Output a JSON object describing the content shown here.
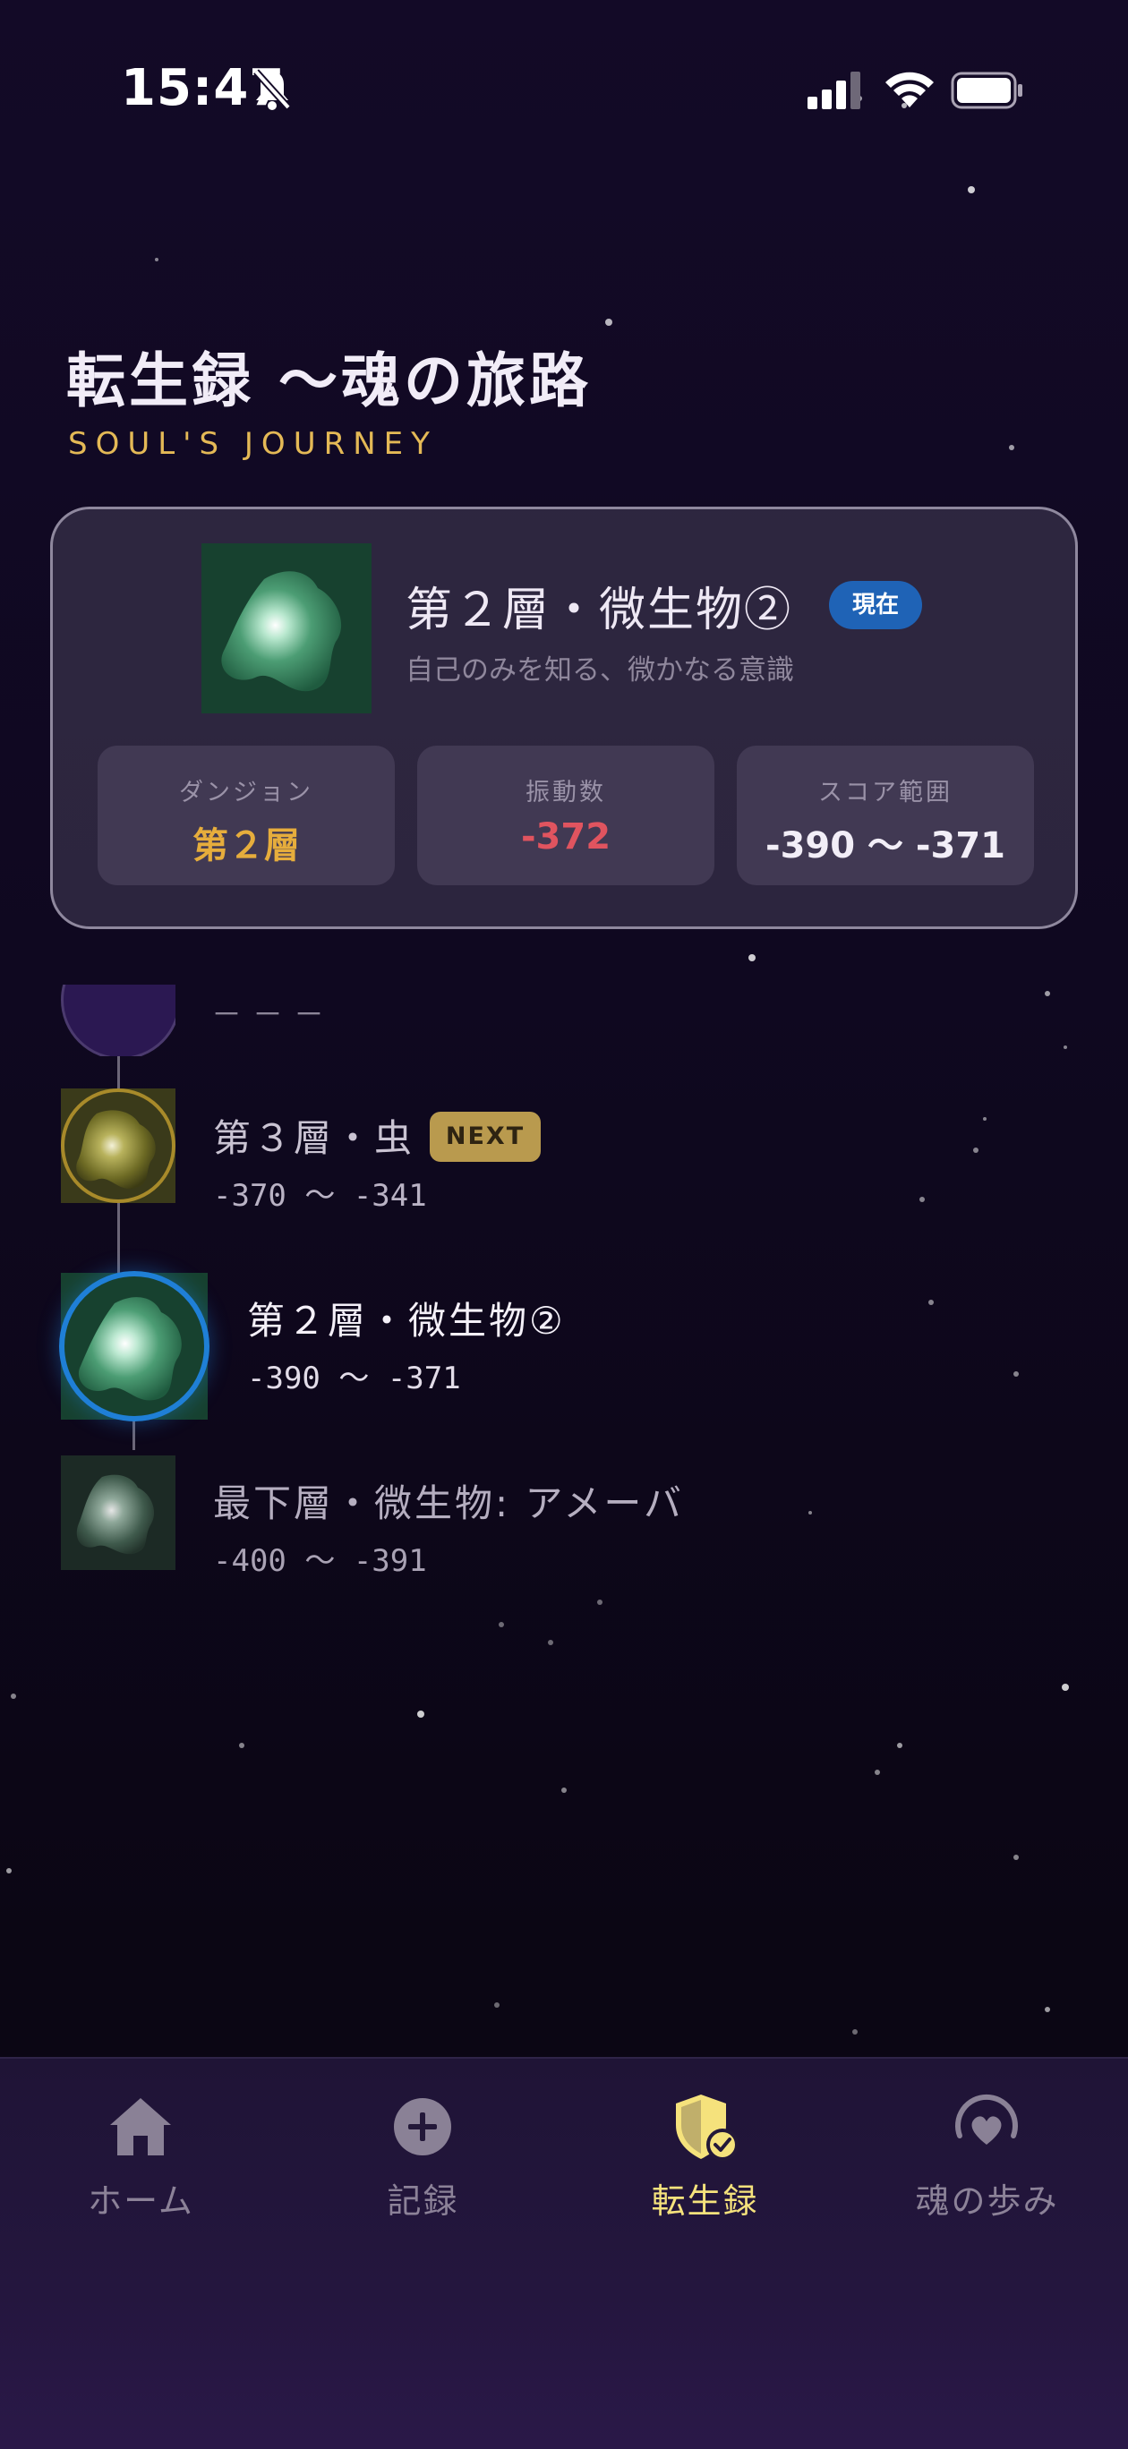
{
  "status_bar": {
    "time": "15:47"
  },
  "header": {
    "title": "転生録 〜魂の旅路",
    "subtitle": "SOUL'S JOURNEY"
  },
  "current": {
    "name": "第２層・微生物②",
    "badge": "現在",
    "description": "自己のみを知る、微かなる意識",
    "stats": [
      {
        "label": "ダンジョン",
        "value": "第２層"
      },
      {
        "label": "振動数",
        "value": "-372"
      },
      {
        "label": "スコア範囲",
        "value": "-390 〜 -371"
      }
    ]
  },
  "timeline": {
    "hidden_placeholder": "－－－",
    "items": [
      {
        "name": "第３層・虫",
        "range": "-370 〜 -341",
        "badge": "NEXT"
      },
      {
        "name": "第２層・微生物②",
        "range": "-390 〜 -371"
      },
      {
        "name": "最下層・微生物: アメーバ",
        "range": "-400 〜 -391"
      }
    ]
  },
  "tabs": [
    {
      "label": "ホーム",
      "icon": "home-icon"
    },
    {
      "label": "記録",
      "icon": "plus-circle-icon"
    },
    {
      "label": "転生録",
      "icon": "shield-check-icon",
      "active": true
    },
    {
      "label": "魂の歩み",
      "icon": "heart-circle-icon"
    }
  ],
  "colors": {
    "accent_gold": "#e4b956",
    "current_blue": "#1f63b6",
    "vibration_red": "#e0545f",
    "active_tab": "#f5e27c"
  }
}
